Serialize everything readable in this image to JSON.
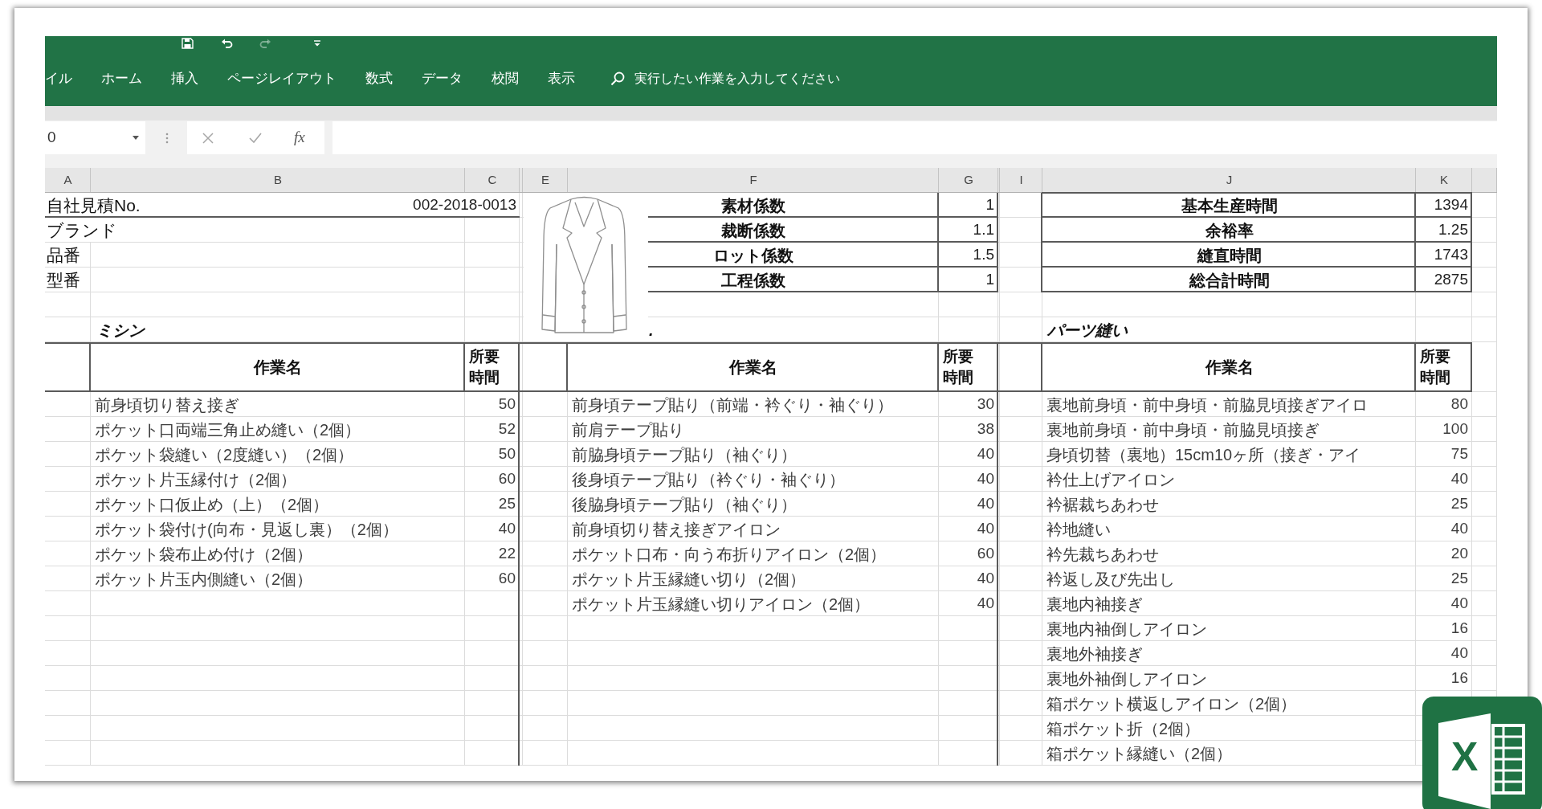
{
  "quick_access": [
    {
      "kind": "save",
      "disabled": false
    },
    {
      "kind": "undo",
      "disabled": false
    },
    {
      "kind": "redo",
      "disabled": true
    },
    {
      "kind": "customize",
      "disabled": false
    }
  ],
  "tabs": [
    {
      "label": "イル",
      "selected": false
    },
    {
      "label": "ホーム",
      "selected": false
    },
    {
      "label": "挿入",
      "selected": false
    },
    {
      "label": "ページレイアウト",
      "selected": false
    },
    {
      "label": "数式",
      "selected": false
    },
    {
      "label": "データ",
      "selected": false
    },
    {
      "label": "校閲",
      "selected": false
    },
    {
      "label": "表示",
      "selected": false
    }
  ],
  "tell_me": {
    "placeholder": "実行したい作業を入力してください"
  },
  "formula_bar": {
    "name_box": "0",
    "function_label": "fx"
  },
  "columns": [
    "A",
    "B",
    "C",
    "E",
    "F",
    "G",
    "I",
    "J",
    "K"
  ],
  "estimate": {
    "label": "自社見積No.",
    "value": "002-2018-0013"
  },
  "fields": [
    "ブランド",
    "品番",
    "型番"
  ],
  "coefficients": [
    {
      "label": "素材係数",
      "value": "1"
    },
    {
      "label": "裁断係数",
      "value": "1.1"
    },
    {
      "label": "ロット係数",
      "value": "1.5"
    },
    {
      "label": "工程係数",
      "value": "1"
    }
  ],
  "totals": [
    {
      "label": "基本生産時間",
      "value": "1394"
    },
    {
      "label": "余裕率",
      "value": "1.25"
    },
    {
      "label": "縫直時間",
      "value": "1743"
    },
    {
      "label": "総合計時間",
      "value": "2875"
    }
  ],
  "sections": [
    {
      "title": "ミシン",
      "name_header": "作業名",
      "time_header": "所要時間",
      "rows": [
        {
          "task": "前身頃切り替え接ぎ",
          "time": "50"
        },
        {
          "task": "ポケット口両端三角止め縫い（2個）",
          "time": "52"
        },
        {
          "task": "ポケット袋縫い（2度縫い）（2個）",
          "time": "50"
        },
        {
          "task": "ポケット片玉縁付け（2個）",
          "time": "60"
        },
        {
          "task": "ポケット口仮止め（上）（2個）",
          "time": "25"
        },
        {
          "task": "ポケット袋付け(向布・見返し裏）（2個）",
          "time": "40"
        },
        {
          "task": "ポケット袋布止め付け（2個）",
          "time": "22"
        },
        {
          "task": "ポケット片玉内側縫い（2個）",
          "time": "60"
        }
      ]
    },
    {
      "title": ".",
      "name_header": "作業名",
      "time_header": "所要時間",
      "rows": [
        {
          "task": "前身頃テープ貼り（前端・衿ぐり・袖ぐり）",
          "time": "30"
        },
        {
          "task": "前肩テープ貼り",
          "time": "38"
        },
        {
          "task": "前脇身頃テープ貼り（袖ぐり）",
          "time": "40"
        },
        {
          "task": "後身頃テープ貼り（衿ぐり・袖ぐり）",
          "time": "40"
        },
        {
          "task": "後脇身頃テープ貼り（袖ぐり）",
          "time": "40"
        },
        {
          "task": "前身頃切り替え接ぎアイロン",
          "time": "40"
        },
        {
          "task": "ポケット口布・向う布折りアイロン（2個）",
          "time": "60"
        },
        {
          "task": "ポケット片玉縁縫い切り（2個）",
          "time": "40"
        },
        {
          "task": "ポケット片玉縁縫い切りアイロン（2個）",
          "time": "40"
        }
      ]
    },
    {
      "title": "パーツ縫い",
      "name_header": "作業名",
      "time_header": "所要時間",
      "rows": [
        {
          "task": "裏地前身頃・前中身頃・前脇見頃接ぎアイロ",
          "time": "80"
        },
        {
          "task": "裏地前身頃・前中身頃・前脇見頃接ぎ",
          "time": "100"
        },
        {
          "task": "身頃切替（裏地）15cm10ヶ所（接ぎ・アイ",
          "time": "75"
        },
        {
          "task": "衿仕上げアイロン",
          "time": "40"
        },
        {
          "task": "衿裾裁ちあわせ",
          "time": "25"
        },
        {
          "task": "衿地縫い",
          "time": "40"
        },
        {
          "task": "衿先裁ちあわせ",
          "time": "20"
        },
        {
          "task": "衿返し及び先出し",
          "time": "25"
        },
        {
          "task": "裏地内袖接ぎ",
          "time": "40"
        },
        {
          "task": "裏地内袖倒しアイロン",
          "time": "16"
        },
        {
          "task": "裏地外袖接ぎ",
          "time": "40"
        },
        {
          "task": "裏地外袖倒しアイロン",
          "time": "16"
        },
        {
          "task": "箱ポケット横返しアイロン（2個）"
        },
        {
          "task": "箱ポケット折（2個）"
        },
        {
          "task": "箱ポケット縁縫い（2個）"
        }
      ]
    }
  ],
  "logo": {
    "letter": "X"
  }
}
